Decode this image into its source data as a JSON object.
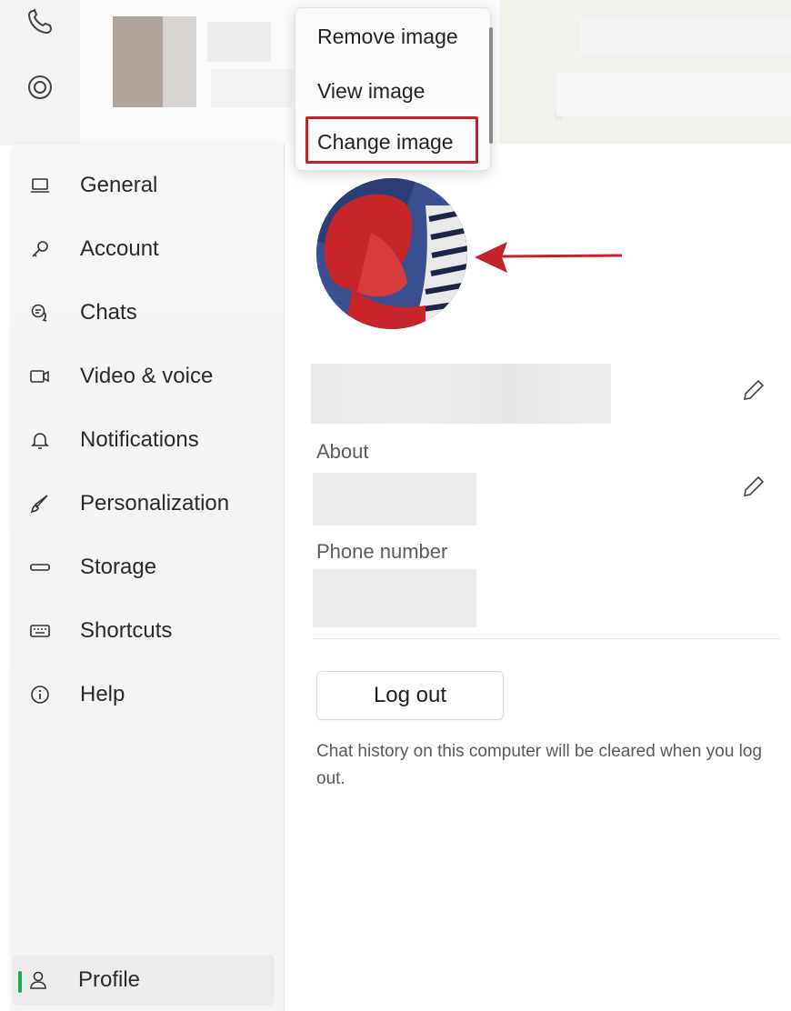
{
  "context_menu": {
    "items": [
      {
        "label": "Remove image"
      },
      {
        "label": "View image"
      },
      {
        "label": "Change image"
      }
    ],
    "highlighted_item": "Change image"
  },
  "nav": {
    "items": [
      {
        "label": "General",
        "icon": "laptop-icon"
      },
      {
        "label": "Account",
        "icon": "key-icon"
      },
      {
        "label": "Chats",
        "icon": "chat-bubbles-icon"
      },
      {
        "label": "Video & voice",
        "icon": "video-camera-icon"
      },
      {
        "label": "Notifications",
        "icon": "bell-icon"
      },
      {
        "label": "Personalization",
        "icon": "brush-icon"
      },
      {
        "label": "Storage",
        "icon": "storage-drive-icon"
      },
      {
        "label": "Shortcuts",
        "icon": "keyboard-icon"
      },
      {
        "label": "Help",
        "icon": "info-icon"
      }
    ],
    "profile": {
      "label": "Profile",
      "icon": "person-icon",
      "active": true
    }
  },
  "rail": {
    "icons": [
      "phone-icon",
      "status-icon"
    ]
  },
  "profile": {
    "about_label": "About",
    "phone_label": "Phone number",
    "logout_label": "Log out",
    "logout_note": "Chat history on this computer will be cleared when you log out."
  },
  "colors": {
    "accent_green": "#1fa855",
    "annotation_red": "#c4232b"
  }
}
